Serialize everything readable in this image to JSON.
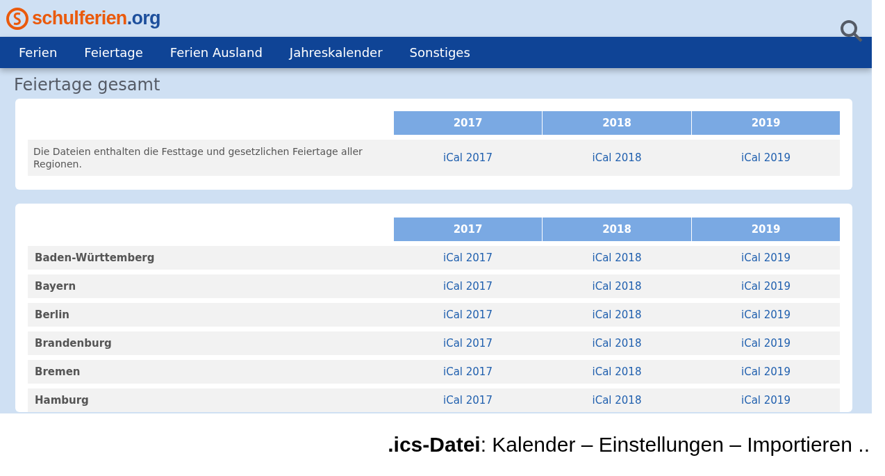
{
  "logo": {
    "main": "schulferien",
    "suffix": ".org"
  },
  "nav": [
    "Ferien",
    "Feiertage",
    "Ferien Ausland",
    "Jahreskalender",
    "Sonstiges"
  ],
  "section_title": "Feiertage gesamt",
  "tables": [
    {
      "columns": [
        "2017",
        "2018",
        "2019"
      ],
      "rows": [
        {
          "kind": "description",
          "label": "Die Dateien enthalten die Festtage und gesetzlichen Feiertage aller Regionen.",
          "links": [
            "iCal 2017",
            "iCal 2018",
            "iCal 2019"
          ]
        }
      ]
    },
    {
      "columns": [
        "2017",
        "2018",
        "2019"
      ],
      "rows": [
        {
          "kind": "region",
          "label": "Baden-Württemberg",
          "links": [
            "iCal 2017",
            "iCal 2018",
            "iCal 2019"
          ]
        },
        {
          "kind": "region",
          "label": "Bayern",
          "links": [
            "iCal 2017",
            "iCal 2018",
            "iCal 2019"
          ]
        },
        {
          "kind": "region",
          "label": "Berlin",
          "links": [
            "iCal 2017",
            "iCal 2018",
            "iCal 2019"
          ]
        },
        {
          "kind": "region",
          "label": "Brandenburg",
          "links": [
            "iCal 2017",
            "iCal 2018",
            "iCal 2019"
          ]
        },
        {
          "kind": "region",
          "label": "Bremen",
          "links": [
            "iCal 2017",
            "iCal 2018",
            "iCal 2019"
          ]
        },
        {
          "kind": "region",
          "label": "Hamburg",
          "links": [
            "iCal 2017",
            "iCal 2018",
            "iCal 2019"
          ]
        }
      ]
    }
  ],
  "caption": "**.ics-Datei**: Kalender – Einstellungen – Importieren .."
}
